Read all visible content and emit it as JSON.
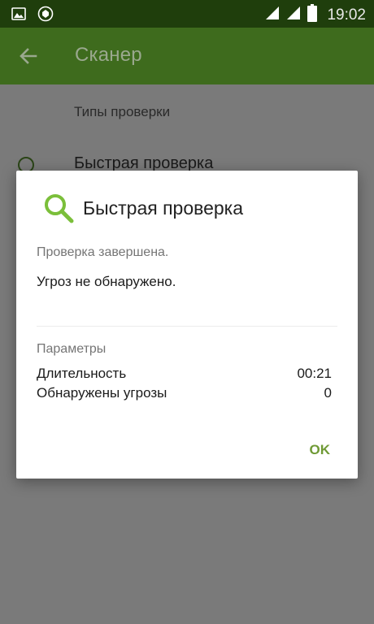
{
  "status_bar": {
    "time": "19:02",
    "left_icons": [
      "image-notification-icon",
      "shield-notification-icon"
    ],
    "right_icons": [
      "signal-icon",
      "signal-icon",
      "battery-icon"
    ]
  },
  "app_bar": {
    "title": "Сканер",
    "back_icon": "arrow-back-icon"
  },
  "content": {
    "section_label": "Типы проверки",
    "scan_item_label": "Быстрая проверка"
  },
  "dialog": {
    "title": "Быстрая проверка",
    "icon": "search-icon",
    "status": "Проверка завершена.",
    "result": "Угроз не обнаружено.",
    "params_title": "Параметры",
    "params": [
      {
        "name": "Длительность",
        "value": "00:21"
      },
      {
        "name": "Обнаружены угрозы",
        "value": "0"
      }
    ],
    "ok_label": "OK"
  },
  "colors": {
    "status_bar": "#1f3e0c",
    "app_bar": "#3e6b1d",
    "accent": "#6f9a35",
    "icon_green": "#7bbf3a"
  }
}
